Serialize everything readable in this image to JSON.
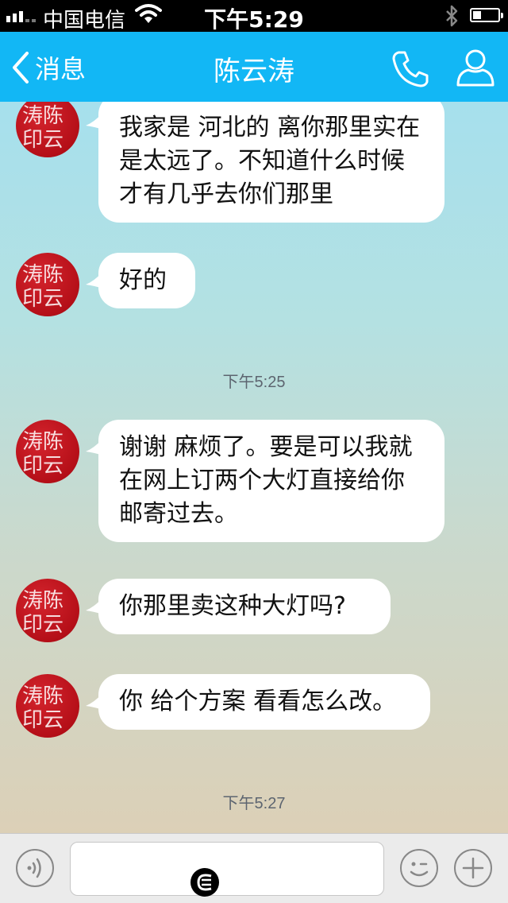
{
  "status_bar": {
    "carrier": "中国电信",
    "time": "下午5:29",
    "signal_bars_filled": 3,
    "signal_bars_total": 5,
    "battery_level": 0.3
  },
  "nav": {
    "back_label": "消息",
    "title": "陈云涛",
    "icons": [
      "back-chevron-icon",
      "phone-icon",
      "profile-icon"
    ]
  },
  "avatar": {
    "seal_text": "涛陈印云",
    "seal_color": "#c01a22"
  },
  "messages": [
    {
      "text": "我家是 河北的 离你那里实在是太远了。不知道什么时候才有几乎去你们那里"
    },
    {
      "text": "好的"
    },
    {
      "text": "谢谢 麻烦了。要是可以我就在网上订两个大灯直接给你邮寄过去。"
    },
    {
      "text": "你那里卖这种大灯吗?"
    },
    {
      "text": "你 给个方案 看看怎么改。"
    }
  ],
  "timestamps": [
    "下午5:25",
    "下午5:27"
  ],
  "input_bar": {
    "placeholder": "",
    "icons": [
      "voice-icon",
      "emoji-icon",
      "plus-icon"
    ]
  },
  "colors": {
    "nav_bg": "#12b7f5",
    "bubble_bg": "#ffffff",
    "timestamp_text": "#5d6570"
  }
}
